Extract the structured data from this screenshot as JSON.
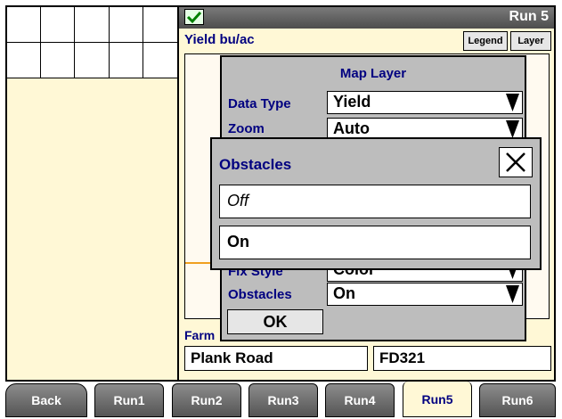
{
  "header": {
    "run_title": "Run 5",
    "yield_label": "Yield bu/ac",
    "legend_label": "Legend",
    "layer_label": "Layer"
  },
  "map_layer": {
    "title": "Map Layer",
    "rows": [
      {
        "label": "Data Type",
        "value": "Yield"
      },
      {
        "label": "Zoom",
        "value": "Auto"
      },
      {
        "label": "Fix Style",
        "value": "Color"
      },
      {
        "label": "Obstacles",
        "value": "On"
      }
    ],
    "ok_label": "OK"
  },
  "obstacles_dialog": {
    "title": "Obstacles",
    "options": [
      "Off",
      "On"
    ],
    "selected": "On"
  },
  "farm": {
    "label": "Farm",
    "value": "Plank Road"
  },
  "field": {
    "value": "FD321"
  },
  "tabs": [
    "Back",
    "Run1",
    "Run2",
    "Run3",
    "Run4",
    "Run5",
    "Run6"
  ],
  "active_tab": "Run5",
  "icons": {
    "status": "checkmark-icon",
    "close": "close-icon",
    "dropdown": "dropdown-arrow-icon"
  },
  "colors": {
    "panel": "#fff8d6",
    "accent_text": "#000080",
    "dialog": "#bdbdbd"
  }
}
